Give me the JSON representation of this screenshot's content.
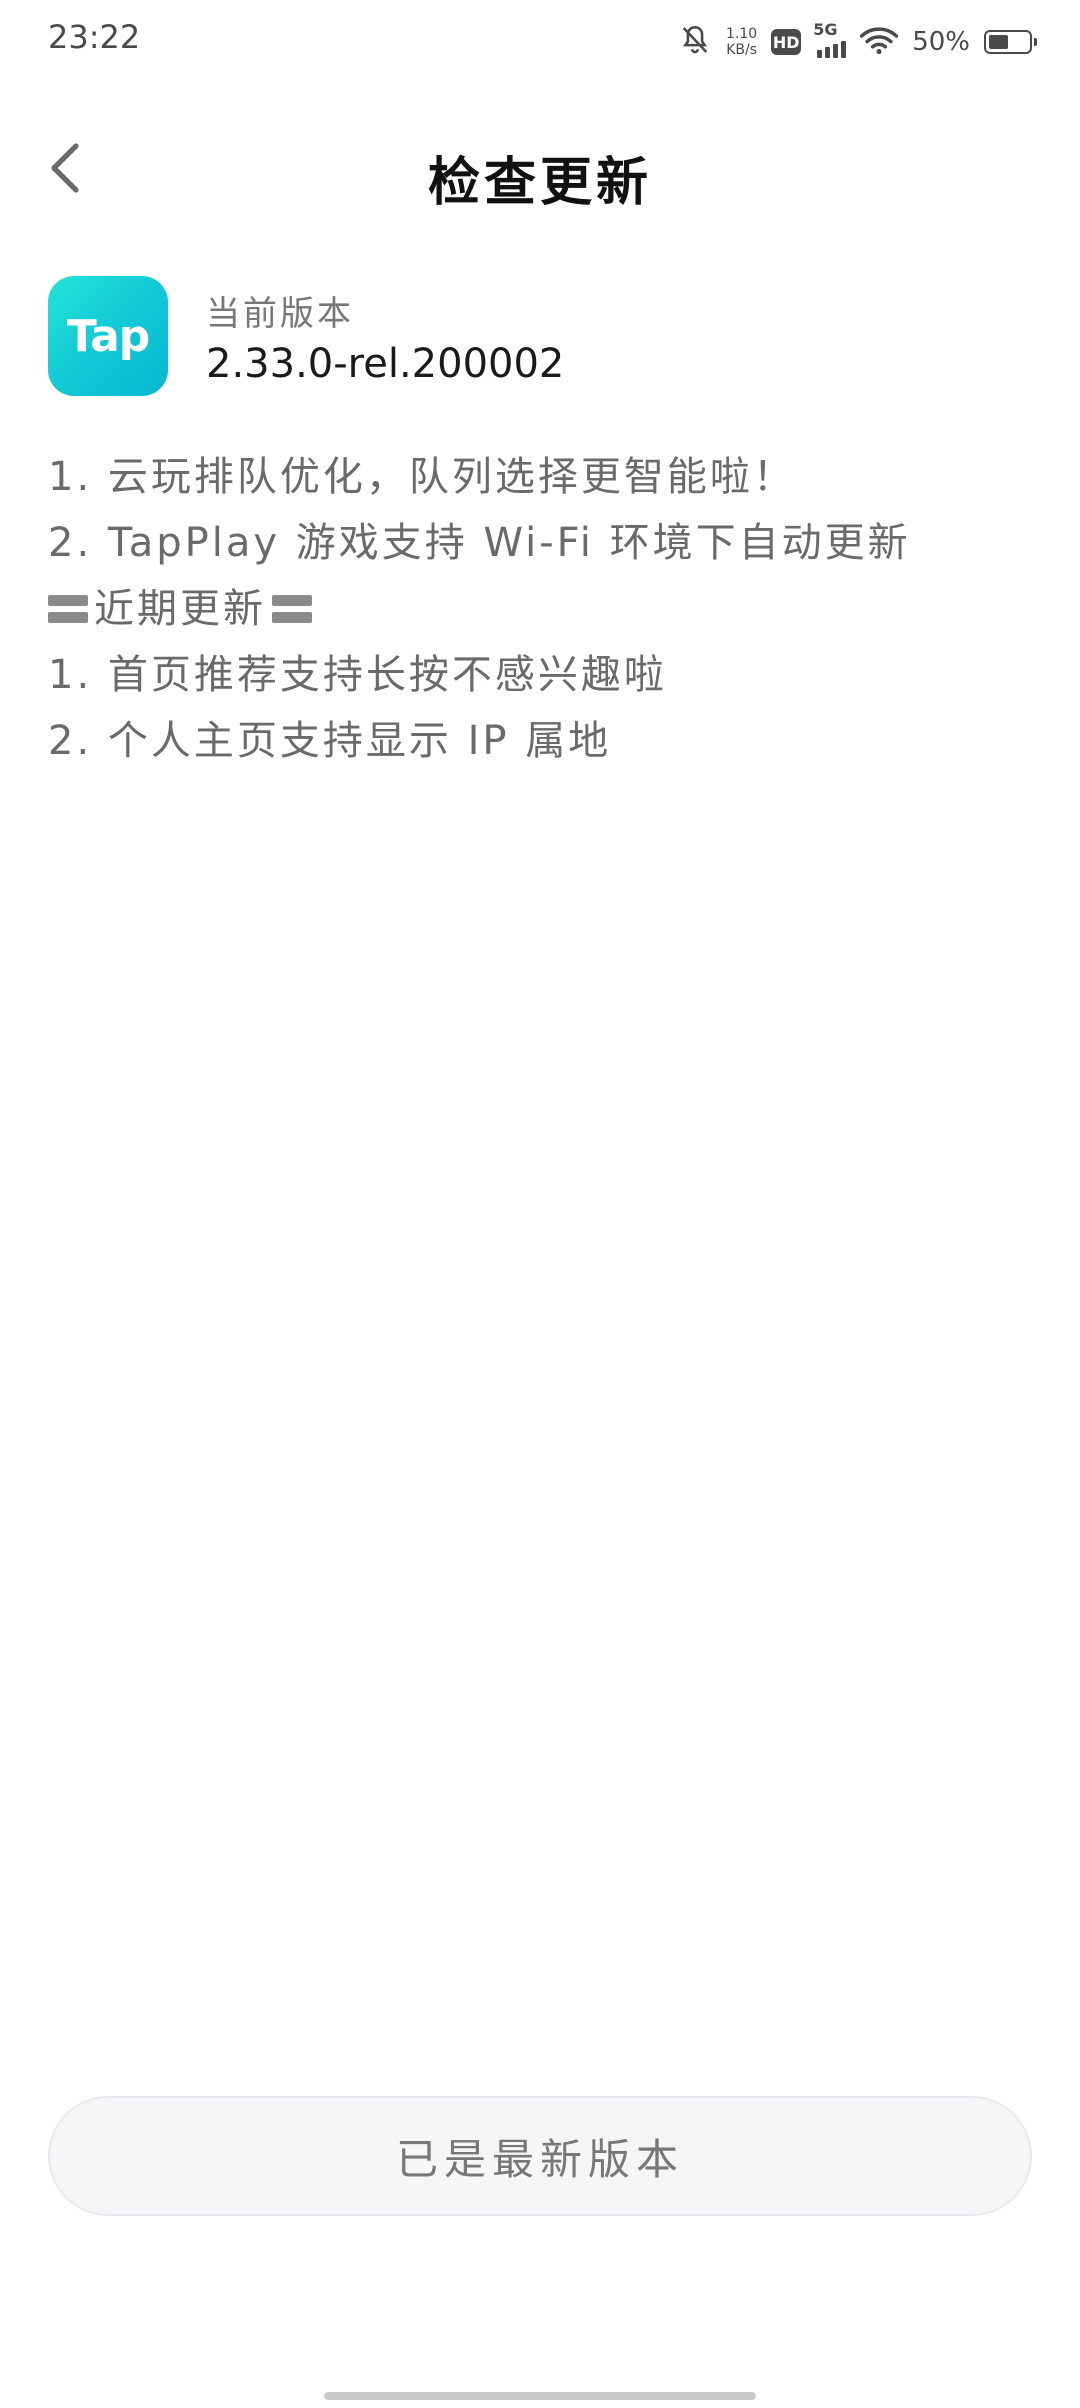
{
  "status_bar": {
    "time": "23:22",
    "net_speed_value": "1.10",
    "net_speed_unit": "KB/s",
    "hd_label": "HD",
    "network_label": "5G",
    "battery_percent": "50%",
    "battery_level": 0.5
  },
  "header": {
    "title": "检查更新"
  },
  "app": {
    "logo_text": "Tap",
    "logo_color": "#14CAD6",
    "version_label": "当前版本",
    "version_value": "2.33.0-rel.200002"
  },
  "notes": {
    "line1": "1. 云玩排队优化，队列选择更智能啦！",
    "line2": "2. TapPlay 游戏支持 Wi-Fi 环境下自动更新",
    "heading": "近期更新",
    "line3": "1. 首页推荐支持长按不感兴趣啦",
    "line4": "2. 个人主页支持显示 IP 属地"
  },
  "footer": {
    "status_button_label": "已是最新版本"
  },
  "icons": {
    "back": "chevron-left-icon",
    "mute": "bell-off-icon",
    "wifi": "wifi-icon",
    "signal": "signal-icon",
    "battery": "battery-icon"
  }
}
